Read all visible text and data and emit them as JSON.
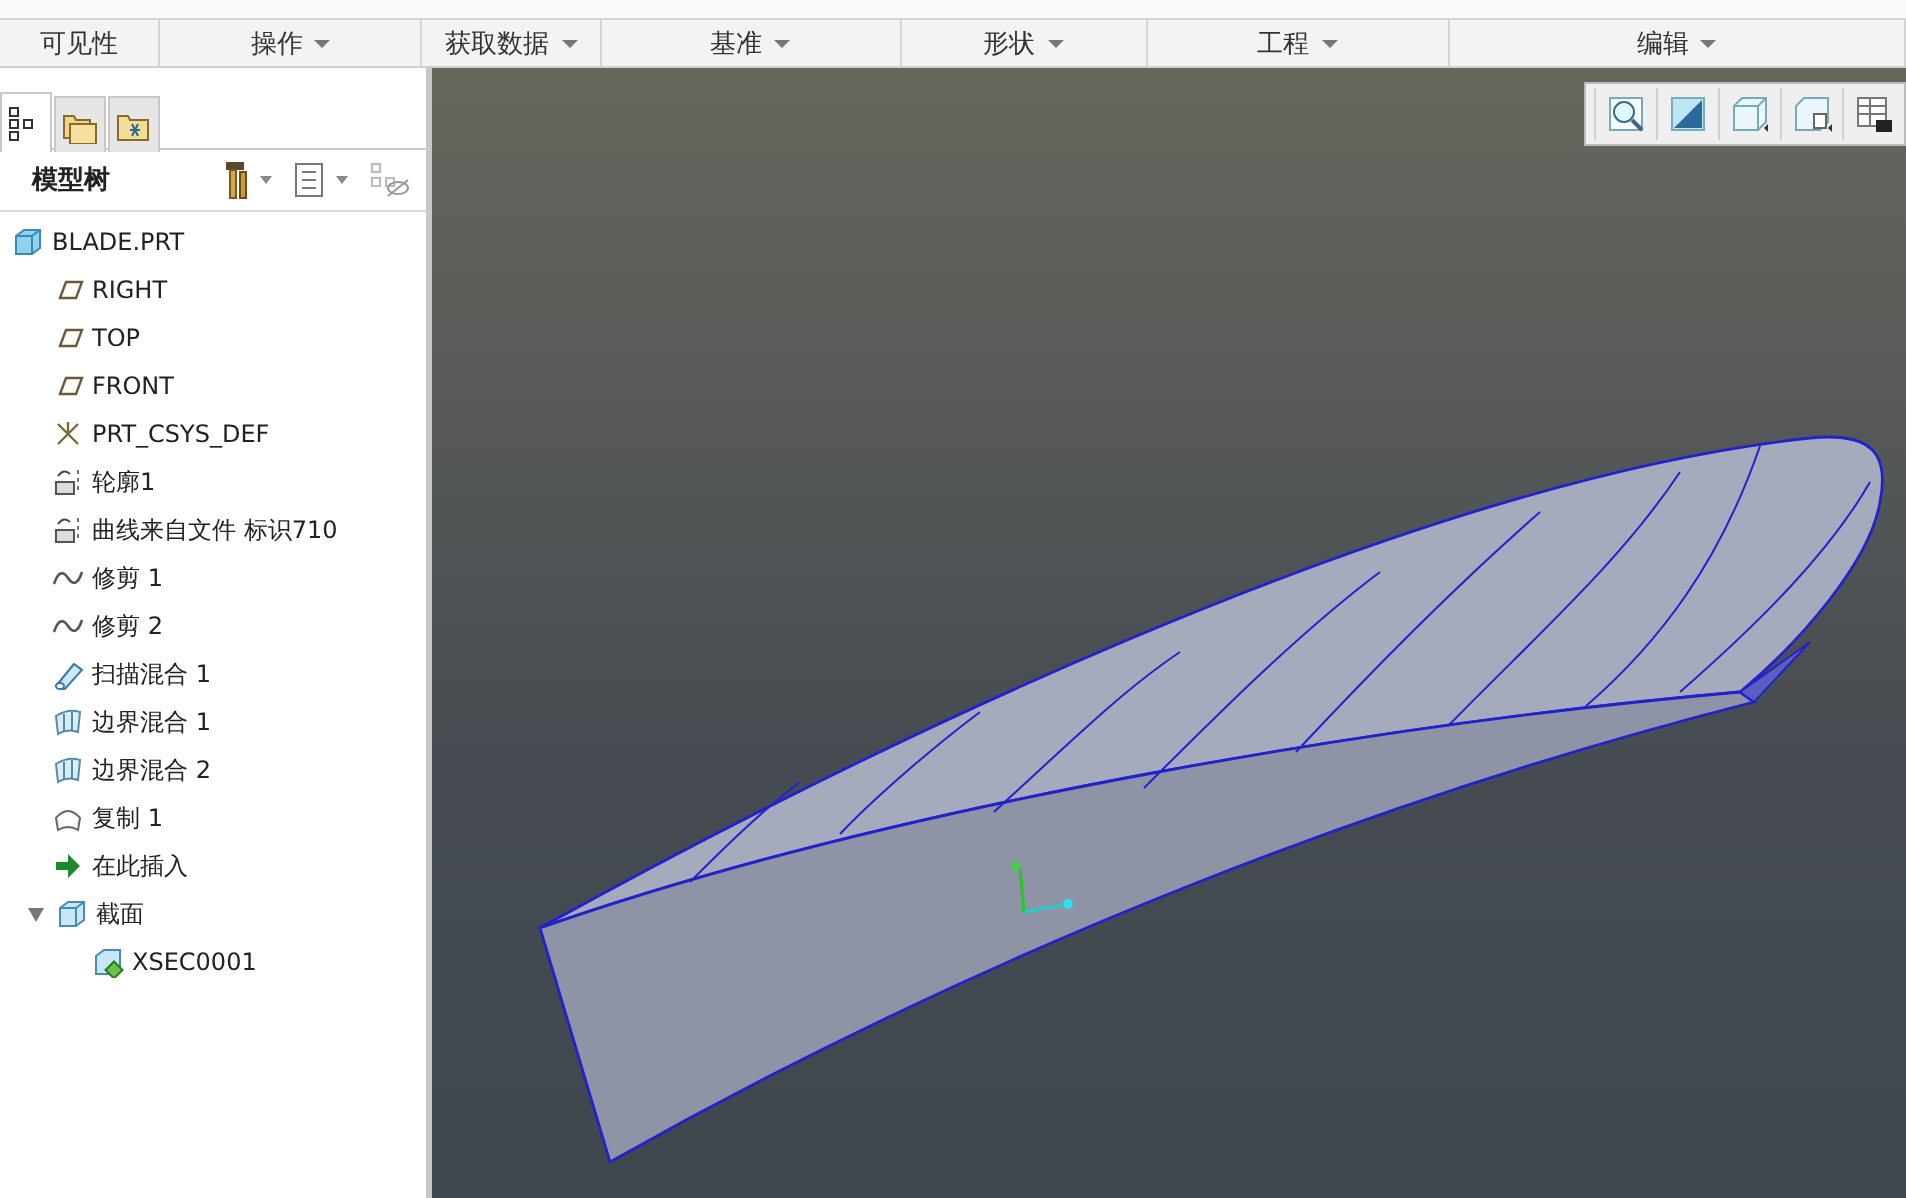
{
  "ribbon_groups": [
    {
      "label": "可见性",
      "dropdown": false
    },
    {
      "label": "操作",
      "dropdown": true
    },
    {
      "label": "获取数据",
      "dropdown": true
    },
    {
      "label": "基准",
      "dropdown": true
    },
    {
      "label": "形状",
      "dropdown": true
    },
    {
      "label": "工程",
      "dropdown": true
    },
    {
      "label": "编辑",
      "dropdown": true
    }
  ],
  "navigator_tabs": [
    {
      "kind": "tree",
      "selected": true
    },
    {
      "kind": "folder",
      "selected": false
    },
    {
      "kind": "favorites",
      "selected": false
    }
  ],
  "model_tree": {
    "title": "模型树",
    "items": [
      {
        "label": "BLADE.PRT",
        "kind": "part",
        "children": [
          {
            "label": "RIGHT",
            "kind": "plane"
          },
          {
            "label": "TOP",
            "kind": "plane"
          },
          {
            "label": "FRONT",
            "kind": "plane"
          },
          {
            "label": "PRT_CSYS_DEF",
            "kind": "csys"
          },
          {
            "label": "轮廓1",
            "kind": "curve-file"
          },
          {
            "label": "曲线来自文件 标识710",
            "kind": "curve-file"
          },
          {
            "label": "修剪 1",
            "kind": "trim"
          },
          {
            "label": "修剪 2",
            "kind": "trim"
          },
          {
            "label": "扫描混合 1",
            "kind": "sweep"
          },
          {
            "label": "边界混合 1",
            "kind": "boundary"
          },
          {
            "label": "边界混合 2",
            "kind": "boundary"
          },
          {
            "label": "复制 1",
            "kind": "copy"
          },
          {
            "label": "在此插入",
            "kind": "insert"
          },
          {
            "label": "截面",
            "kind": "section-group",
            "expanded": true,
            "children": [
              {
                "label": "XSEC0001",
                "kind": "section"
              }
            ]
          }
        ]
      }
    ]
  },
  "view_toolbar": [
    {
      "kind": "zoom"
    },
    {
      "kind": "repaint"
    },
    {
      "kind": "shading"
    },
    {
      "kind": "view-manager"
    },
    {
      "kind": "saved-views"
    }
  ]
}
